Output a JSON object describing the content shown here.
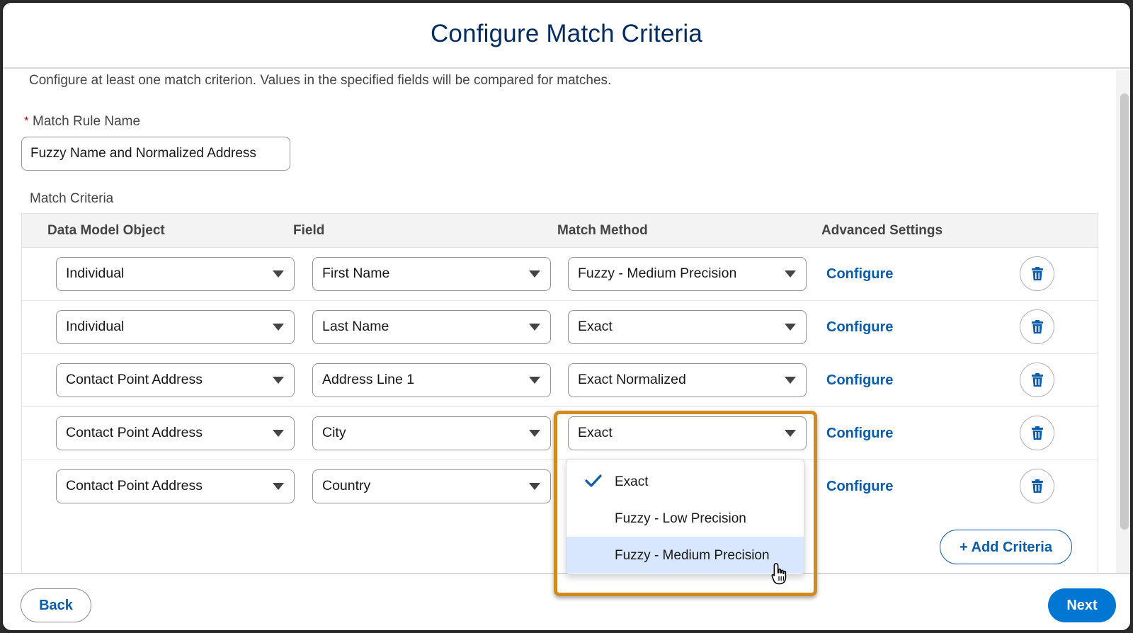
{
  "header": {
    "title": "Configure Match Criteria"
  },
  "intro": "Configure at least one match criterion. Values in the specified fields will be compared for matches.",
  "rule": {
    "required_mark": "*",
    "label": "Match Rule Name",
    "value": "Fuzzy Name and Normalized Address"
  },
  "criteria_label": "Match Criteria",
  "table": {
    "headers": [
      "Data Model Object",
      "Field",
      "Match Method",
      "Advanced Settings"
    ],
    "rows": [
      {
        "object": "Individual",
        "field": "First Name",
        "method": "Fuzzy - Medium Precision",
        "action": "Configure"
      },
      {
        "object": "Individual",
        "field": "Last Name",
        "method": "Exact",
        "action": "Configure"
      },
      {
        "object": "Contact Point Address",
        "field": "Address Line 1",
        "method": "Exact Normalized",
        "action": "Configure"
      },
      {
        "object": "Contact Point Address",
        "field": "City",
        "method": "Exact",
        "action": "Configure"
      },
      {
        "object": "Contact Point Address",
        "field": "Country",
        "method": "",
        "action": "Configure"
      }
    ]
  },
  "dropdown": {
    "options": [
      "Exact",
      "Fuzzy - Low Precision",
      "Fuzzy - Medium Precision"
    ],
    "selected": "Exact",
    "hovered": "Fuzzy - Medium Precision"
  },
  "add_criteria_label": "+ Add Criteria",
  "footer": {
    "back_label": "Back",
    "next_label": "Next"
  },
  "colors": {
    "brand": "#0176d3",
    "link": "#0b5cab",
    "title": "#032d60",
    "highlight": "#d28a1e",
    "hover": "#d8e6fe",
    "required": "#ba0517"
  },
  "icons": {
    "row_action": "trash-icon",
    "select_caret": "caret-down-icon",
    "selected_option": "checkmark-icon",
    "pointer": "hand-cursor-icon"
  }
}
